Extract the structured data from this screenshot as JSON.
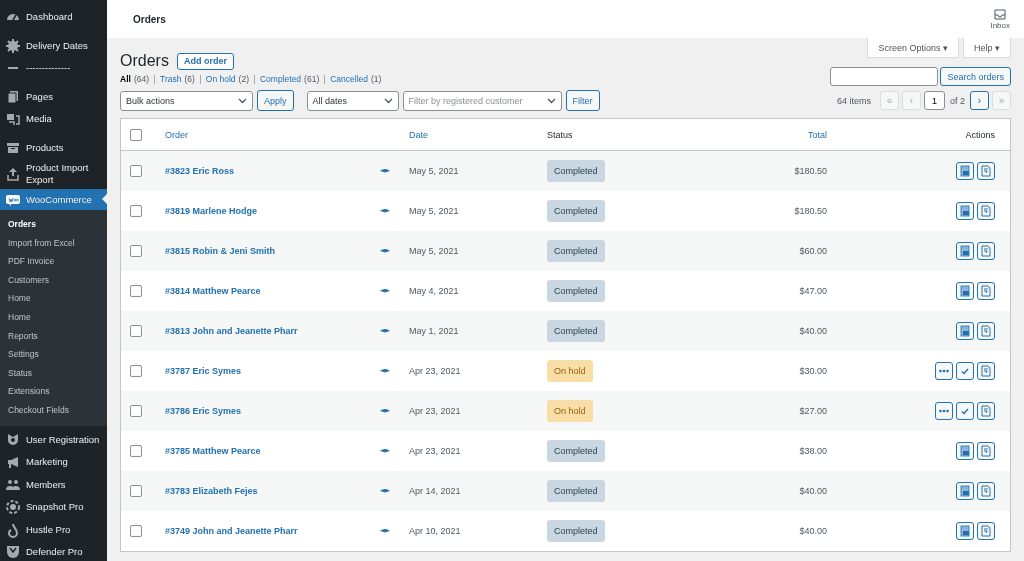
{
  "sidebar": {
    "items": [
      {
        "label": "Dashboard",
        "selected": false
      },
      {
        "label": "Delivery Dates",
        "selected": false
      },
      {
        "label": "--------------",
        "selected": false
      },
      {
        "label": "Pages",
        "selected": false
      },
      {
        "label": "Media",
        "selected": false
      },
      {
        "label": "Products",
        "selected": false
      },
      {
        "label": "Product Import Export",
        "selected": false
      },
      {
        "label": "WooCommerce",
        "selected": true,
        "children": [
          {
            "label": "Orders",
            "selected": true
          },
          {
            "label": "Import from Excel",
            "selected": false
          },
          {
            "label": "PDF Invoice",
            "selected": false
          },
          {
            "label": "Customers",
            "selected": false
          },
          {
            "label": "Home",
            "selected": false
          },
          {
            "label": "Home",
            "selected": false
          },
          {
            "label": "Reports",
            "selected": false
          },
          {
            "label": "Settings",
            "selected": false
          },
          {
            "label": "Status",
            "selected": false
          },
          {
            "label": "Extensions",
            "selected": false
          },
          {
            "label": "Checkout Fields",
            "selected": false
          }
        ]
      },
      {
        "label": "User Registration",
        "selected": false
      },
      {
        "label": "Marketing",
        "selected": false
      },
      {
        "label": "Members",
        "selected": false
      },
      {
        "label": "Snapshot Pro",
        "selected": false
      },
      {
        "label": "Hustle Pro",
        "selected": false
      },
      {
        "label": "Defender Pro",
        "selected": false
      }
    ]
  },
  "topbar": {
    "title": "Orders",
    "inbox": "Inbox"
  },
  "screen_tabs": [
    "Screen Options ▾",
    "Help ▾"
  ],
  "heading": "Orders",
  "add_button": "Add order",
  "views": [
    {
      "label": "All",
      "count": "(64)",
      "selected": true
    },
    {
      "label": "Trash",
      "count": "(6)",
      "selected": false
    },
    {
      "label": "On hold",
      "count": "(2)",
      "selected": false
    },
    {
      "label": "Completed",
      "count": "(61)",
      "selected": false
    },
    {
      "label": "Cancelled",
      "count": "(1)",
      "selected": false
    }
  ],
  "search_button": "Search orders",
  "bulk_actions": "Bulk actions",
  "apply": "Apply",
  "dates": "All dates",
  "customer_filter": {
    "placeholder": "Filter by registered customer"
  },
  "filter": "Filter",
  "pagination": {
    "count": "64 items",
    "page": "1",
    "of": "of 2",
    "buttons": [
      {
        "label": "«",
        "disabled": true
      },
      {
        "label": "‹",
        "disabled": true
      },
      {
        "label": "›",
        "disabled": false
      },
      {
        "label": "»",
        "disabled": true
      }
    ]
  },
  "table": {
    "select_all_checked": false,
    "columns": [
      {
        "label": "Order",
        "sortable": true
      },
      {
        "label": "Date",
        "sortable": true
      },
      {
        "label": "Status",
        "sortable": false
      },
      {
        "label": "Total",
        "sortable": true
      },
      {
        "label": "Actions",
        "sortable": false
      }
    ],
    "rows": [
      {
        "order": "#3823 Eric Ross",
        "date": "May 5, 2021",
        "status": {
          "label": "Completed",
          "kind": "completed"
        },
        "total": "$180.50",
        "actions": [
          {
            "kind": "invoice"
          },
          {
            "kind": "slip"
          }
        ],
        "checked": false
      },
      {
        "order": "#3819 Marlene Hodge",
        "date": "May 5, 2021",
        "status": {
          "label": "Completed",
          "kind": "completed"
        },
        "total": "$180.50",
        "actions": [
          {
            "kind": "invoice"
          },
          {
            "kind": "slip"
          }
        ],
        "checked": false
      },
      {
        "order": "#3815 Robin & Jeni Smith",
        "date": "May 5, 2021",
        "status": {
          "label": "Completed",
          "kind": "completed"
        },
        "total": "$60.00",
        "actions": [
          {
            "kind": "invoice"
          },
          {
            "kind": "slip"
          }
        ],
        "checked": false
      },
      {
        "order": "#3814 Matthew Pearce",
        "date": "May 4, 2021",
        "status": {
          "label": "Completed",
          "kind": "completed"
        },
        "total": "$47.00",
        "actions": [
          {
            "kind": "invoice"
          },
          {
            "kind": "slip"
          }
        ],
        "checked": false
      },
      {
        "order": "#3813 John and Jeanette Pharr",
        "date": "May 1, 2021",
        "status": {
          "label": "Completed",
          "kind": "completed"
        },
        "total": "$40.00",
        "actions": [
          {
            "kind": "invoice"
          },
          {
            "kind": "slip"
          }
        ],
        "checked": false
      },
      {
        "order": "#3787 Eric Symes",
        "date": "Apr 23, 2021",
        "status": {
          "label": "On hold",
          "kind": "on-hold"
        },
        "total": "$30.00",
        "actions": [
          {
            "kind": "processing"
          },
          {
            "kind": "complete"
          },
          {
            "kind": "slip"
          }
        ],
        "checked": false
      },
      {
        "order": "#3786 Eric Symes",
        "date": "Apr 23, 2021",
        "status": {
          "label": "On hold",
          "kind": "on-hold"
        },
        "total": "$27.00",
        "actions": [
          {
            "kind": "processing"
          },
          {
            "kind": "complete"
          },
          {
            "kind": "slip"
          }
        ],
        "checked": false
      },
      {
        "order": "#3785 Matthew Pearce",
        "date": "Apr 23, 2021",
        "status": {
          "label": "Completed",
          "kind": "completed"
        },
        "total": "$38.00",
        "actions": [
          {
            "kind": "invoice"
          },
          {
            "kind": "slip"
          }
        ],
        "checked": false
      },
      {
        "order": "#3783 Elizabeth Fejes",
        "date": "Apr 14, 2021",
        "status": {
          "label": "Completed",
          "kind": "completed"
        },
        "total": "$40.00",
        "actions": [
          {
            "kind": "invoice"
          },
          {
            "kind": "slip"
          }
        ],
        "checked": false
      },
      {
        "order": "#3749 John and Jeanette Pharr",
        "date": "Apr 10, 2021",
        "status": {
          "label": "Completed",
          "kind": "completed"
        },
        "total": "$40.00",
        "actions": [
          {
            "kind": "invoice"
          },
          {
            "kind": "slip"
          }
        ],
        "checked": false
      }
    ]
  }
}
